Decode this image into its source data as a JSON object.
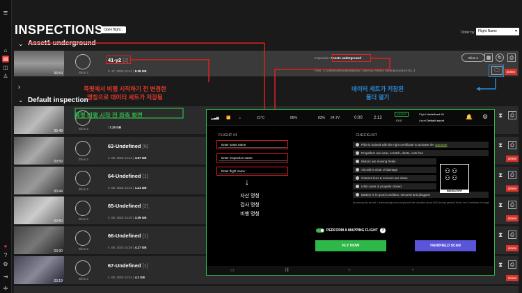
{
  "app": {
    "title": "INSPECTIONS",
    "open_flight": "Open flight..."
  },
  "order_by": {
    "label": "Order by",
    "value": "Flight Name"
  },
  "groups": {
    "asset1": "Asset1 underground",
    "default": "Default inspection"
  },
  "selected": {
    "name": "41-y2",
    "count": "[2]",
    "date": "3. 17. 2023 12:41",
    "size": "8.38 GB",
    "duration": "06:54",
    "drone": "Elios 3",
    "inspection_label": "Inspection:",
    "inspection_value": "Asset1 underground",
    "path_label": "Path:",
    "path_value": "C:/Users/user/Desktop/대모 자료/041-Asset1 underground-y2-02_4"
  },
  "default_rows": [
    {
      "name": "",
      "count": "",
      "date": "",
      "size": "7.20 GB",
      "duration": "05:48",
      "drone": "Elios 3"
    },
    {
      "name": "63-Undefined",
      "count": "[6]",
      "date": "4. 06. 2023 14:12",
      "size": "4.57 GB",
      "duration": "03:59",
      "drone": "Elios 3"
    },
    {
      "name": "64-Undefined",
      "count": "[1]",
      "date": "4. 06. 2023 14:15",
      "size": "1.21 GB",
      "duration": "00:44",
      "drone": "Elios 3"
    },
    {
      "name": "65-Undefined",
      "count": "[2]",
      "date": "4. 06. 2023 14:20",
      "size": "3.39 GB",
      "duration": "02:50",
      "drone": "Elios 3"
    },
    {
      "name": "66-Undefined",
      "count": "[1]",
      "date": "4. 06. 2023 14:26",
      "size": "4.17 GB",
      "duration": "03:30",
      "drone": "Elios 3"
    },
    {
      "name": "67-Undefined",
      "count": "[1]",
      "date": "4. 06. 2023 14:31",
      "size": "4.1 GB",
      "duration": "03:19",
      "drone": "Elios 3"
    }
  ],
  "delete_label": "delete",
  "annotations": {
    "red_line1": "콕핏에서 비행 시작하기 전 변경한",
    "red_line2": "명칭으로 데이터 세트가 저장됨",
    "blue_line1": "데이터 세트가 저장된",
    "blue_line2": "폴더 열기",
    "green": "콕핏 비행 시작 전 좌측 화면",
    "kor1": "자산 명칭",
    "kor2": "검사 명칭",
    "kor3": "비행 명칭"
  },
  "tablet": {
    "status_temp": "21°C",
    "status_batt": "86%",
    "status_batt2": "83%",
    "status_volt": "24.7V",
    "status_time1": "0:00",
    "status_time2": "2:12",
    "status_assist": "ASSIST",
    "status_idle": "IDLE",
    "flight_name_label": "Flight",
    "flight_name_value": "Undefined #1",
    "asset_label": "Asset",
    "asset_value": "Default asset",
    "flight_title": "FLIGHT #1",
    "asset_placeholder": "Enter asset name",
    "inspection_placeholder": "Enter inspection name",
    "flight_placeholder": "Enter flight name",
    "checklist_title": "CHECKLIST",
    "checklist": [
      "Pilot is trained with the right certificate to activate the",
      "Propellers are wear, scratch, dents, cuts free",
      "Motors are moving freely",
      "Aircraft is clear of damage",
      "Camera lens & sensors are clean",
      "USB cover is properly closed",
      "Battery is in good condition, secured and plugged"
    ],
    "warrantie": "warrante",
    "agree": "By arming the aircraft, I acknowledge and comply with the checklist above AND accept general Terms and Conditions of usage",
    "mandatory": "MANDATORY",
    "mapping": "PERFORM A MAPPING FLIGHT",
    "fly_now": "FLY NOW",
    "handheld": "HANDHELD SCAN"
  }
}
